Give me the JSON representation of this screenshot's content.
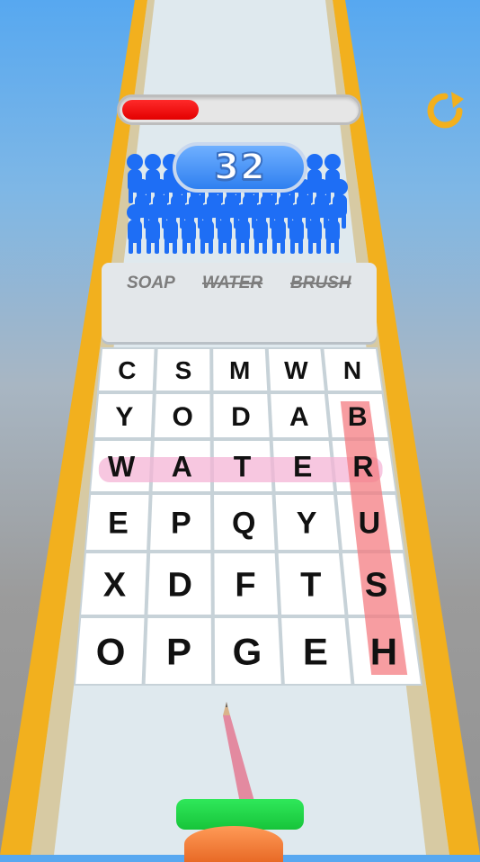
{
  "hud": {
    "progress_fraction": 0.32,
    "progress_color": "#ff1a1a",
    "restart_icon": "restart-arrow-icon",
    "score": "32"
  },
  "words": [
    {
      "text": "SOAP",
      "found": false
    },
    {
      "text": "WATER",
      "found": true
    },
    {
      "text": "BRUSH",
      "found": true
    }
  ],
  "grid": [
    [
      "C",
      "S",
      "M",
      "W",
      "N"
    ],
    [
      "Y",
      "O",
      "D",
      "A",
      "B"
    ],
    [
      "W",
      "A",
      "T",
      "E",
      "R"
    ],
    [
      "E",
      "P",
      "Q",
      "Y",
      "U"
    ],
    [
      "X",
      "D",
      "F",
      "T",
      "S"
    ],
    [
      "O",
      "P",
      "G",
      "E",
      "H"
    ]
  ],
  "highlights": [
    {
      "word": "WATER",
      "direction": "horizontal",
      "color": "#f4b4d6"
    },
    {
      "word": "BRUSH",
      "direction": "vertical",
      "color": "#f47c82"
    }
  ],
  "colors": {
    "track": "#dfe9ee",
    "rail": "#f2b01e",
    "crowd": "#1e6ef5",
    "pencil_bar": "#22d94a"
  }
}
